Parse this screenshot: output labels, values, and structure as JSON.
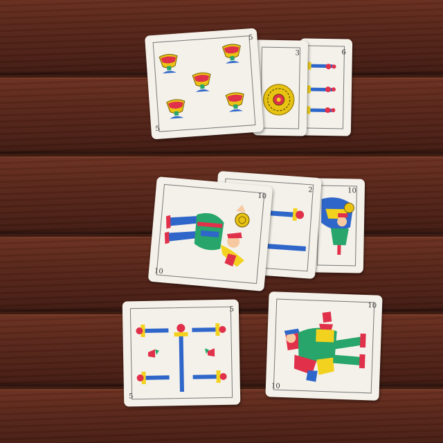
{
  "photo": {
    "subject": "spanish-playing-cards-on-wood",
    "colors": {
      "wood": "#5a271a",
      "card": "#f4f1ea",
      "blue": "#2f66c9",
      "red": "#e0304a",
      "yellow": "#f2d21e",
      "green": "#27a56a"
    }
  },
  "cards": [
    {
      "id": "cups-5",
      "suit": "cups",
      "rank": "5"
    },
    {
      "id": "coins-3",
      "suit": "coins",
      "rank": "3"
    },
    {
      "id": "swords-6",
      "suit": "swords",
      "rank": "6"
    },
    {
      "id": "coins-10",
      "suit": "coins",
      "rank": "10"
    },
    {
      "id": "swords-2",
      "suit": "swords",
      "rank": "2"
    },
    {
      "id": "cups-10",
      "suit": "cups",
      "rank": "10"
    },
    {
      "id": "swords-5",
      "suit": "swords",
      "rank": "5"
    },
    {
      "id": "clubs-10",
      "suit": "clubs",
      "rank": "10"
    }
  ]
}
